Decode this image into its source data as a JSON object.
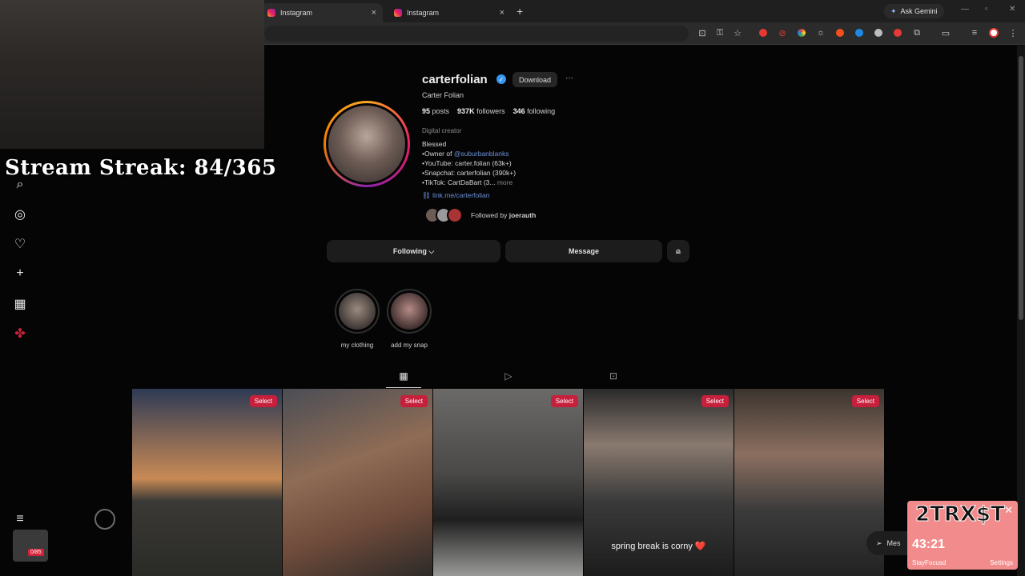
{
  "browser": {
    "tabs": [
      {
        "label": "Instagram",
        "active": true
      },
      {
        "label": "Instagram",
        "active": false
      }
    ],
    "new_tab_label": "+",
    "ask_gemini_label": "Ask Gemini"
  },
  "overlay": {
    "stream_streak_text": "Stream Streak: 84/365",
    "focus_widget": {
      "logo_text": "2TRX$T",
      "timer": "43:21",
      "app_name": "StayFocusd",
      "settings_label": "Settings",
      "close_glyph": "✕"
    },
    "app_badge": "0/85"
  },
  "profile": {
    "username": "carterfolian",
    "verified": true,
    "download_label": "Download",
    "more_label": "···",
    "full_name": "Carter Folian",
    "stats": {
      "posts": "95",
      "posts_label": "posts",
      "followers": "937K",
      "followers_label": "followers",
      "following": "346",
      "following_label": "following"
    },
    "category": "Digital creator",
    "bio": {
      "line1": "Blessed",
      "line2_prefix": "•Owner of ",
      "line2_link": "@suburbanblanks",
      "line3": "•YouTube: carter.folian (63k+)",
      "line4": "•Snapchat: carterfolian (390k+)",
      "line5": "•TikTok: CartDaBart (3...",
      "more": "more"
    },
    "external_link": "link.me/carterfolian",
    "followed_by_prefix": "Followed by",
    "followed_by_user": "joerauth",
    "buttons": {
      "following": "Following ⌵",
      "message": "Message",
      "suggest_icon": "add-person-icon"
    },
    "highlights": [
      {
        "label": "my clothing"
      },
      {
        "label": "add my snap"
      }
    ]
  },
  "grid": {
    "tabs": [
      "posts-grid-icon",
      "reels-icon",
      "tagged-icon"
    ],
    "tiles": [
      {
        "select_label": "Select",
        "caption": ""
      },
      {
        "select_label": "Select",
        "caption": ""
      },
      {
        "select_label": "Select",
        "caption": ""
      },
      {
        "select_label": "Select",
        "caption": "spring break is corny ❤️"
      },
      {
        "select_label": "Select",
        "caption": ""
      }
    ]
  },
  "messages_pill_label": "Mes",
  "colors": {
    "accent_select": "#c6203c",
    "link": "#6c8fd6",
    "verified": "#3897f0",
    "focus_widget_bg": "#f28b8b"
  }
}
